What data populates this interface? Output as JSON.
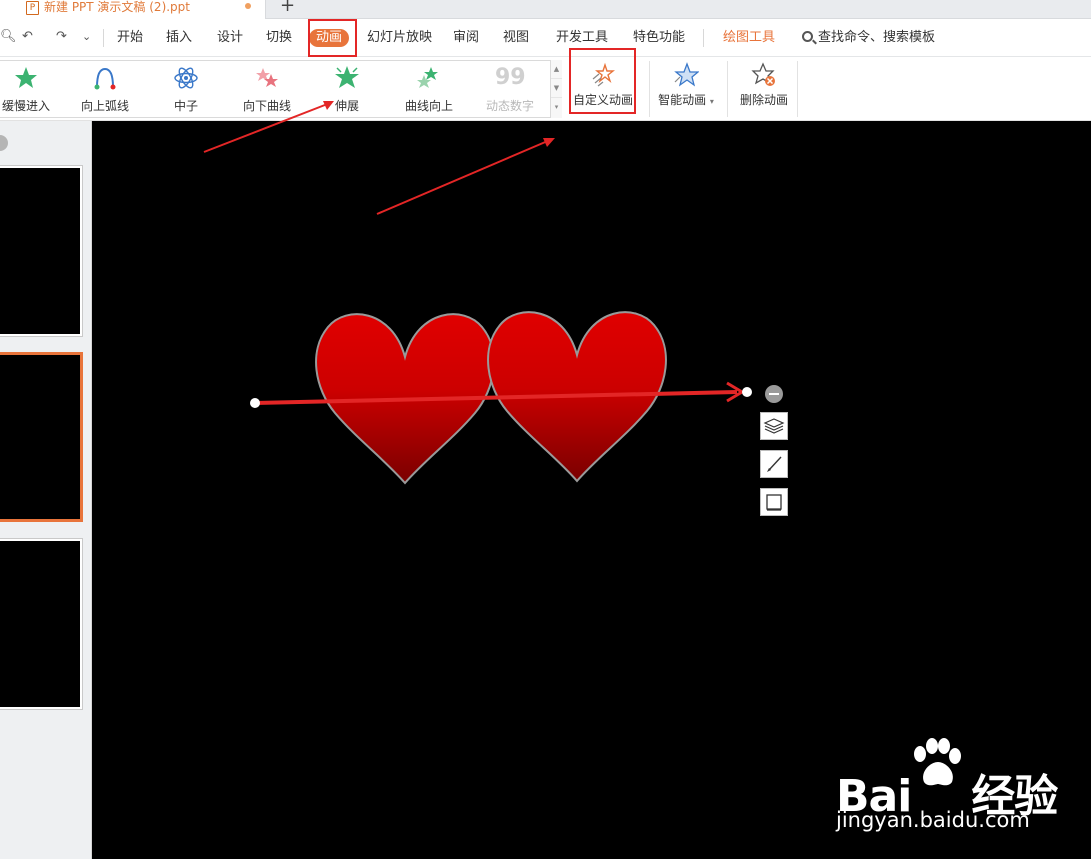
{
  "tab": {
    "doc_icon": "P",
    "title": "新建 PPT 演示文稿 (2).ppt",
    "new_tab": "+"
  },
  "quick_access": {
    "undo": "↶",
    "redo": "↷",
    "more": "⌄"
  },
  "menu": {
    "items": [
      "开始",
      "插入",
      "设计",
      "切换",
      "动画",
      "幻灯片放映",
      "审阅",
      "视图",
      "开发工具",
      "特色功能",
      "绘图工具"
    ],
    "active": "动画",
    "search_text": "查找命令、搜索模板"
  },
  "ribbon": {
    "gallery": [
      {
        "label": "缓慢进入",
        "icon": "green-star-icon"
      },
      {
        "label": "向上弧线",
        "icon": "arc-up-icon"
      },
      {
        "label": "中子",
        "icon": "atom-icon"
      },
      {
        "label": "向下曲线",
        "icon": "pink-stars-icon"
      },
      {
        "label": "伸展",
        "icon": "green-star-icon"
      },
      {
        "label": "曲线向上",
        "icon": "green-stars-icon"
      },
      {
        "label": "动态数字",
        "icon": "digits-icon",
        "glyph": "99",
        "disabled": true
      }
    ],
    "custom_animation": "自定义动画",
    "smart_animation": "智能动画",
    "delete_animation": "删除动画"
  },
  "watermark": {
    "logo_left": "Bai",
    "logo_right": "经验",
    "url": "jingyan.baidu.com"
  },
  "colors": {
    "accent": "#e8743b",
    "annotation_red": "#e32626",
    "heart_top": "#e00000",
    "heart_bottom": "#7a0000"
  }
}
